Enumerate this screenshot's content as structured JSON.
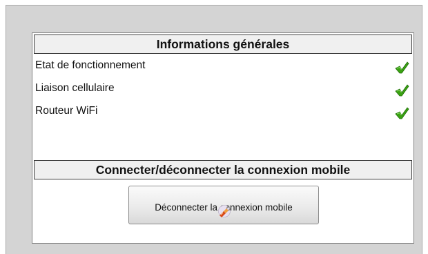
{
  "general_info": {
    "title": "Informations générales",
    "rows": [
      {
        "label": "Etat de fonctionnement",
        "status_icon": "check-icon",
        "status_color": "#3aa212"
      },
      {
        "label": "Liaison cellulaire",
        "status_icon": "check-icon",
        "status_color": "#3aa212"
      },
      {
        "label": "Routeur WiFi",
        "status_icon": "check-icon",
        "status_color": "#3aa212"
      }
    ]
  },
  "connection": {
    "title": "Connecter/déconnecter la connexion mobile",
    "button_label": "Déconnecter la connexion mobile",
    "button_icon": "unplug-icon"
  }
}
